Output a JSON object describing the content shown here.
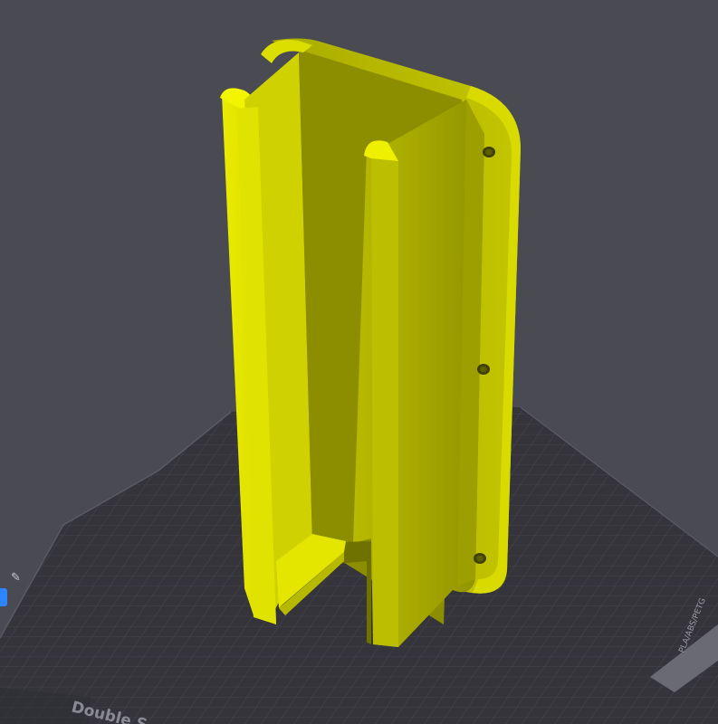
{
  "viewport": {
    "background_color": "#4a4a52",
    "bed_color": "#35353b",
    "bed_grid_color": "#4b4b53",
    "model_color": "#e5e700"
  },
  "bed": {
    "label_left": "Double S",
    "label_right": "PLA/ABS/PETG"
  },
  "side_icons": {
    "edit_icon": "edit-pencil-icon",
    "badge_color": "#2d86ff"
  }
}
